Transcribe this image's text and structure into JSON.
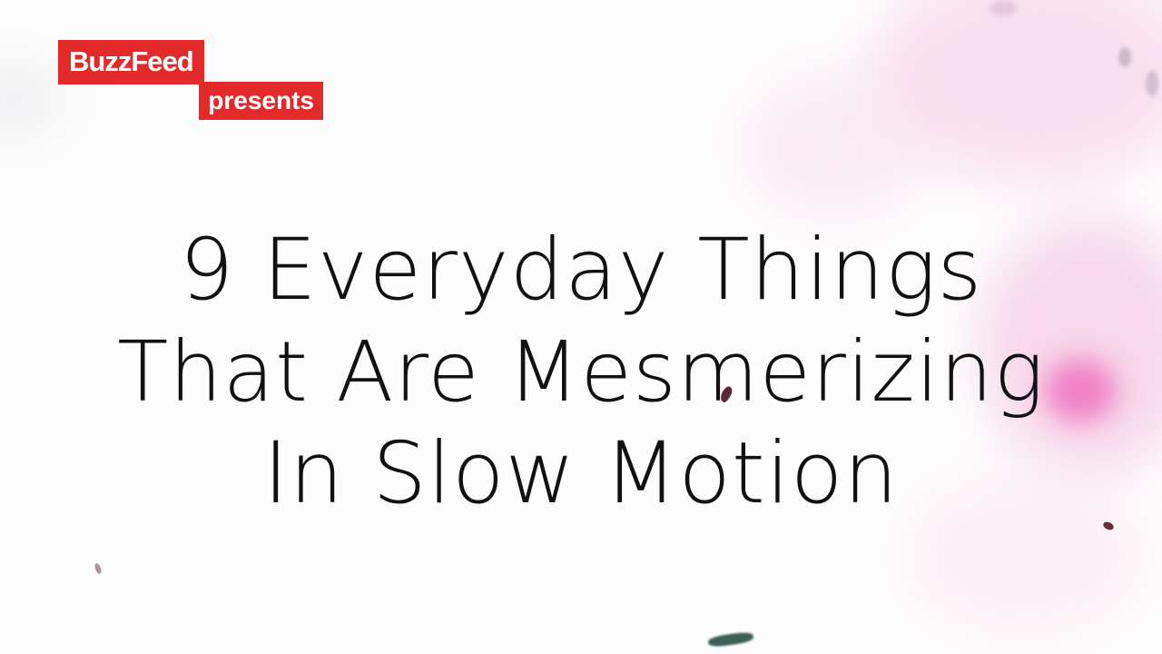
{
  "logo": {
    "brand": "BuzzFeed",
    "tagline": "presents",
    "brand_color": "#e32a2a"
  },
  "title": {
    "line1": "9 Everyday Things",
    "line2": "That Are Mesmerizing",
    "line3": "In Slow Motion"
  },
  "colors": {
    "background": "#fdfcfd",
    "text": "#111111",
    "splash_accent": "#eb3caa"
  }
}
